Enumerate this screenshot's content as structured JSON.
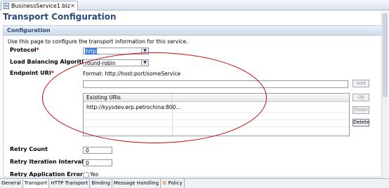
{
  "editor": {
    "tab_label": "BusinessService1.biz",
    "close_glyph": "✕"
  },
  "page": {
    "title": "Transport Configuration",
    "section_title": "Configuration",
    "description": "Use this page to configure the transport information for this service."
  },
  "protocol": {
    "label": "Protocol",
    "required_mark": "*",
    "value": "http"
  },
  "load_balancing": {
    "label": "Load Balancing Algorithm",
    "value": "round-robin"
  },
  "endpoint": {
    "label": "Endpoint URI",
    "required_mark": "*",
    "format_text": "Format:   http://host:port/someService",
    "new_uri_value": "",
    "buttons": {
      "add": "Add",
      "up": "Up",
      "down": "Down",
      "delete": "Delete"
    },
    "table": {
      "columns": [
        "Existing URIs",
        ""
      ],
      "rows": [
        [
          "http://kyysdev.erp.petrochina:800...",
          ""
        ]
      ]
    }
  },
  "retry_count": {
    "label": "Retry Count",
    "value": "0"
  },
  "retry_interval": {
    "label": "Retry Iteration Interval",
    "value": "0"
  },
  "retry_app_errors": {
    "label": "Retry Application Errors",
    "option_yes": "Yes"
  },
  "bottom_tabs": [
    "General",
    "Transport",
    "HTTP Transport",
    "Binding",
    "Message Handling",
    "Policy"
  ],
  "colors": {
    "title": "#2a4a7c",
    "annotation_oval": "#d00000",
    "selection": "#3a78d8"
  }
}
